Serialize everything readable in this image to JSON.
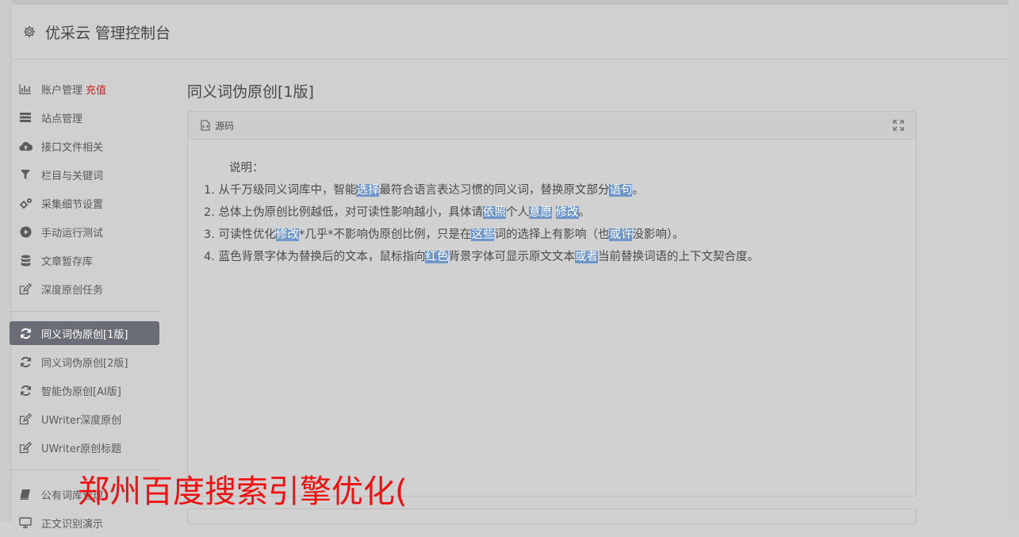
{
  "app": {
    "title": "优采云 管理控制台"
  },
  "sidebar": {
    "group1": [
      {
        "label": "账户管理",
        "extra": "充值",
        "icon": "bar-chart-icon"
      },
      {
        "label": "站点管理",
        "icon": "server-icon"
      },
      {
        "label": "接口文件相关",
        "icon": "cloud-upload-icon"
      },
      {
        "label": "栏目与关键词",
        "icon": "filter-icon"
      },
      {
        "label": "采集细节设置",
        "icon": "gears-icon"
      },
      {
        "label": "手动运行测试",
        "icon": "play-circle-icon"
      },
      {
        "label": "文章暂存库",
        "icon": "database-icon"
      },
      {
        "label": "深度原创任务",
        "icon": "edit-icon"
      }
    ],
    "group2": [
      {
        "label": "同义词伪原创[1版]",
        "icon": "refresh-icon",
        "active": true
      },
      {
        "label": "同义词伪原创[2版]",
        "icon": "refresh-icon"
      },
      {
        "label": "智能伪原创[AI版]",
        "icon": "refresh-icon"
      },
      {
        "label": "UWriter深度原创",
        "icon": "edit-icon"
      },
      {
        "label": "UWriter原创标题",
        "icon": "edit-icon"
      }
    ],
    "group3": [
      {
        "label": "公有词库管理",
        "icon": "book-icon"
      },
      {
        "label": "正文识别演示",
        "icon": "monitor-icon"
      }
    ]
  },
  "main": {
    "page_title": "同义词伪原创[1版]",
    "panel": {
      "header_label": "源码",
      "intro": "说明：",
      "lines": [
        [
          {
            "t": "1. 从千万级同义词库中，智能"
          },
          {
            "t": "选择",
            "hl": true
          },
          {
            "t": "最符合语言表达习惯的同义词，替换原文部分"
          },
          {
            "t": "语句",
            "hl": true
          },
          {
            "t": "。"
          }
        ],
        [
          {
            "t": "2. 总体上伪原创比例越低，对可读性影响越小，具体请"
          },
          {
            "t": "依照",
            "hl": true
          },
          {
            "t": "个人"
          },
          {
            "t": "意愿",
            "hl": true
          },
          {
            "t": " "
          },
          {
            "t": "修改",
            "hl": true
          },
          {
            "t": "。"
          }
        ],
        [
          {
            "t": "3. 可读性优化"
          },
          {
            "t": "修改",
            "hl": true
          },
          {
            "t": "*几乎*不影响伪原创比例，只是在"
          },
          {
            "t": "这些",
            "hl": true
          },
          {
            "t": "词的选择上有影响（也"
          },
          {
            "t": "或许",
            "hl": true
          },
          {
            "t": "没影响）。"
          }
        ],
        [
          {
            "t": "4. 蓝色背景字体为替换后的文本，鼠标指向"
          },
          {
            "t": "红色",
            "hl": true
          },
          {
            "t": "背景字体可显示原文文本"
          },
          {
            "t": "或者",
            "hl": true
          },
          {
            "t": "当前替换词语的上下文契合度。"
          }
        ]
      ]
    }
  },
  "overlay": {
    "watermark": "郑州百度搜索引擎优化("
  },
  "colors": {
    "highlight": "#6f96c8",
    "active_nav": "#6a6d75",
    "accent_red": "#cc2222",
    "watermark": "#f01010"
  }
}
